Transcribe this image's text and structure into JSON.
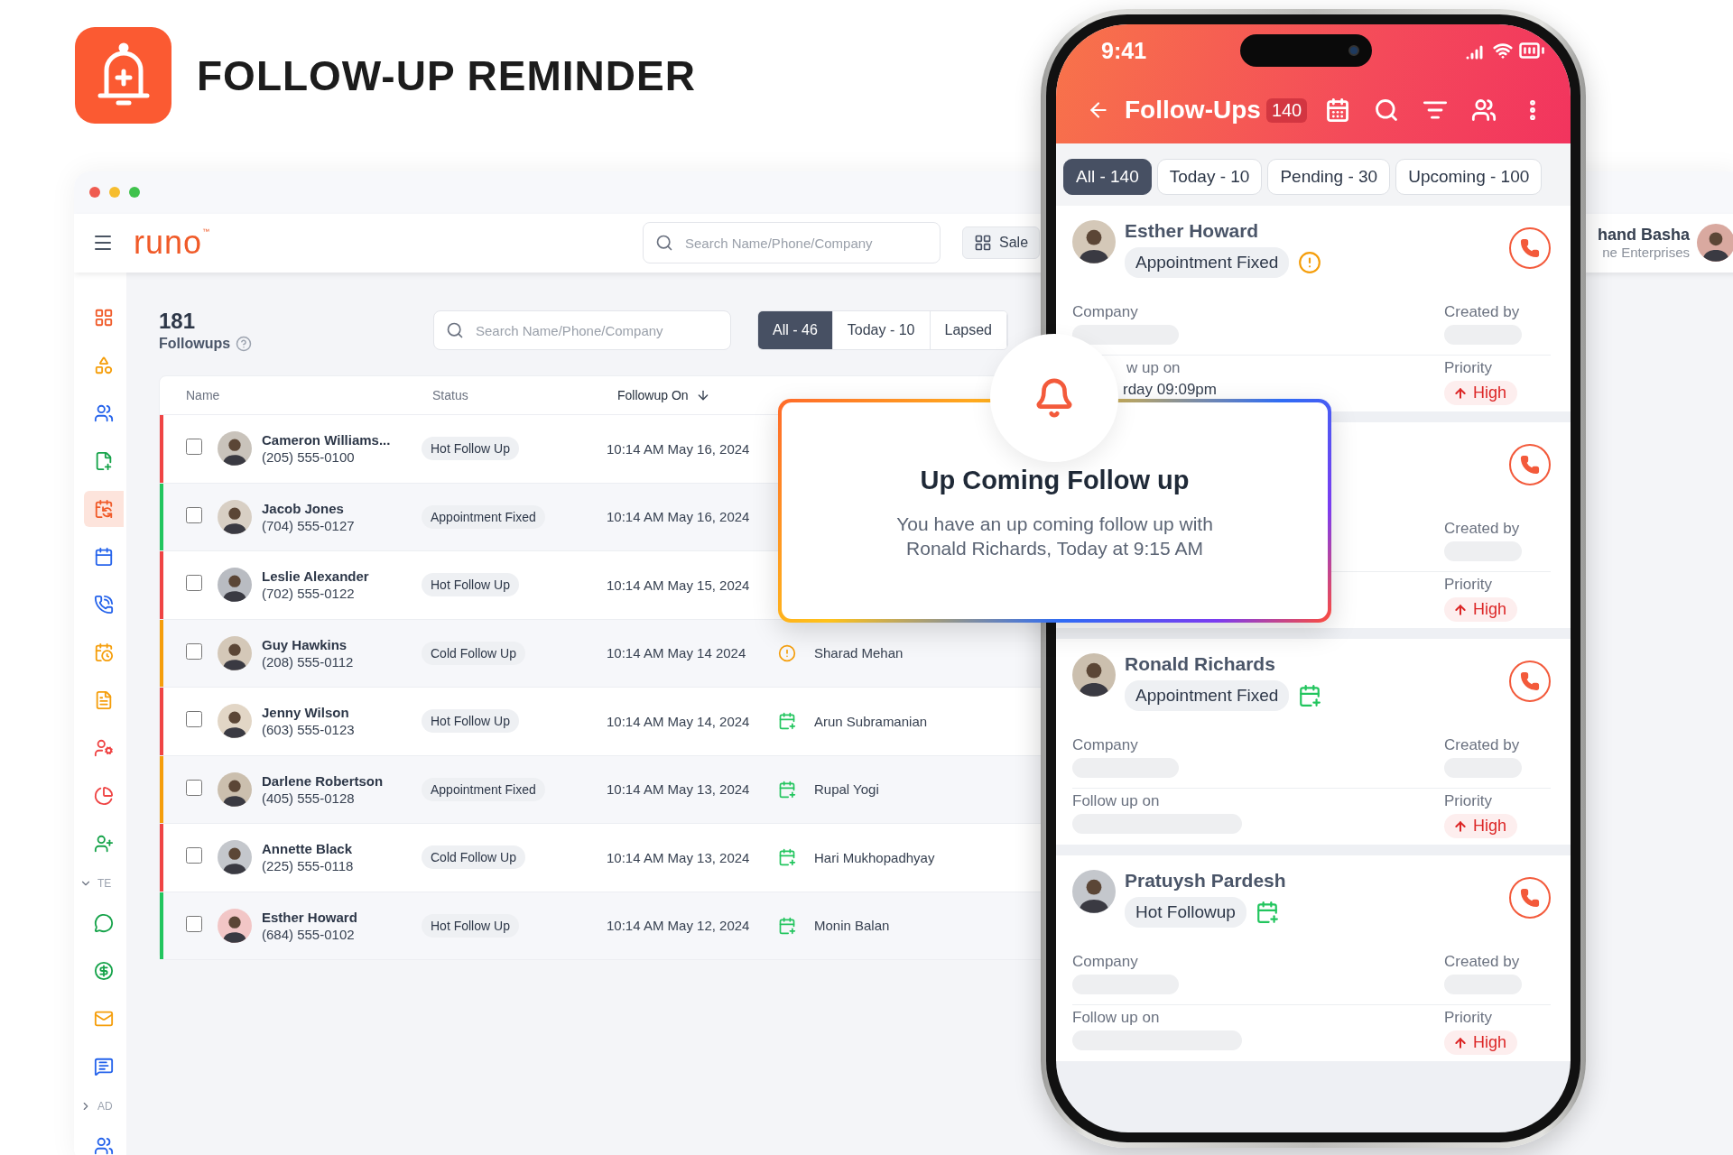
{
  "hero": {
    "title": "FOLLOW-UP REMINDER"
  },
  "desktop": {
    "brand": "runo",
    "brand_mark": "™",
    "search_placeholder": "Search Name/Phone/Company",
    "sales_button": "Sale",
    "user": {
      "name": "hand Basha",
      "company": "ne Enterprises"
    },
    "sidebar": [
      {
        "kind": "grid",
        "selected": false
      },
      {
        "kind": "shapes",
        "selected": false
      },
      {
        "kind": "team",
        "selected": false
      },
      {
        "kind": "list-add",
        "selected": false
      },
      {
        "kind": "calendar-sync",
        "selected": true
      },
      {
        "kind": "calendar",
        "selected": false
      },
      {
        "kind": "calls",
        "selected": false
      },
      {
        "kind": "calendar-clock",
        "selected": false
      },
      {
        "kind": "document",
        "selected": false
      },
      {
        "kind": "user-cog",
        "selected": false
      },
      {
        "kind": "pie",
        "selected": false
      },
      {
        "kind": "user-add",
        "selected": false
      },
      {
        "kind": "section",
        "label": "TE",
        "expanded": true
      },
      {
        "kind": "chat",
        "selected": false
      },
      {
        "kind": "coin",
        "selected": false
      },
      {
        "kind": "mail",
        "selected": false
      },
      {
        "kind": "message",
        "selected": false
      },
      {
        "kind": "section",
        "label": "AD",
        "expanded": false
      },
      {
        "kind": "team-user",
        "selected": false
      }
    ],
    "count": "181",
    "count_label": "Followups",
    "list_search_placeholder": "Search Name/Phone/Company",
    "tabs": [
      {
        "label": "All - 46",
        "selected": true
      },
      {
        "label": "Today - 10",
        "selected": false
      },
      {
        "label": "Lapsed",
        "selected": false
      }
    ],
    "columns": [
      {
        "label": "Name",
        "sorted": false
      },
      {
        "label": "Status",
        "sorted": false
      },
      {
        "label": "Followup On",
        "sorted": true
      }
    ],
    "rows": [
      {
        "checked": false,
        "name": "Cameron Williams...",
        "phone": "(205) 555-0100",
        "status": "Hot Follow Up",
        "followup_on": "10:14 AM May 16, 2024",
        "color": "#ef4444"
      },
      {
        "checked": false,
        "name": "Jacob Jones",
        "phone": "(704) 555-0127",
        "status": "Appointment Fixed",
        "followup_on": "10:14 AM May 16, 2024",
        "color": "#22c55e"
      },
      {
        "checked": false,
        "name": "Leslie Alexander",
        "phone": "(702) 555-0122",
        "status": "Hot Follow Up",
        "followup_on": "10:14 AM May 15, 2024",
        "color": "#ef4444"
      },
      {
        "checked": false,
        "name": "Guy Hawkins",
        "phone": "(208) 555-0112",
        "status": "Cold Follow Up",
        "followup_on": "10:14 AM May 14 2024",
        "flag": {
          "kind": "warning"
        },
        "owner": "Sharad Mehan",
        "color": "#f59e0b"
      },
      {
        "checked": false,
        "name": "Jenny Wilson",
        "phone": "(603) 555-0123",
        "status": "Hot Follow Up",
        "followup_on": "10:14 AM May 14, 2024",
        "flag": {
          "kind": "calendar"
        },
        "owner": "Arun Subramanian",
        "color": "#ef4444"
      },
      {
        "checked": false,
        "name": "Darlene Robertson",
        "phone": "(405) 555-0128",
        "status": "Appointment Fixed",
        "followup_on": "10:14 AM May 13, 2024",
        "flag": {
          "kind": "calendar"
        },
        "owner": "Rupal Yogi",
        "color": "#f59e0b"
      },
      {
        "checked": false,
        "name": "Annette Black",
        "phone": "(225) 555-0118",
        "status": "Cold Follow Up",
        "followup_on": "10:14 AM May 13, 2024",
        "flag": {
          "kind": "calendar"
        },
        "owner": "Hari Mukhopadhyay",
        "color": "#ef4444"
      },
      {
        "checked": false,
        "name": "Esther Howard",
        "phone": "(684) 555-0102",
        "status": "Hot Follow Up",
        "followup_on": "10:14 AM May 12, 2024",
        "flag": {
          "kind": "calendar"
        },
        "owner": "Monin Balan",
        "color": "#22c55e"
      }
    ]
  },
  "phone": {
    "time": "9:41",
    "title": "Follow-Ups",
    "count": "140",
    "tabs": [
      {
        "label": "All - 140",
        "selected": true
      },
      {
        "label": "Today - 10",
        "selected": false
      },
      {
        "label": "Pending - 30",
        "selected": false
      },
      {
        "label": "Upcoming - 100",
        "selected": false
      }
    ],
    "cards": [
      {
        "name": "Esther Howard",
        "status": "Appointment Fixed",
        "flag": {
          "kind": "warning"
        },
        "company_label": "Company",
        "created_by_label": "Created by",
        "follow_up_label": "w up on",
        "follow_up_value": "rday 09:09pm",
        "priority_label": "Priority",
        "priority": "High"
      },
      {
        "created_by_label": "Created by",
        "priority_label": "Priority",
        "priority": "High"
      },
      {
        "name": "Ronald Richards",
        "status": "Appointment Fixed",
        "flag": {
          "kind": "calendar"
        },
        "company_label": "Company",
        "created_by_label": "Created by",
        "follow_up_label": "Follow up on",
        "priority_label": "Priority",
        "priority": "High"
      },
      {
        "name": "Pratuysh Pardesh",
        "status": "Hot Followup",
        "flag": {
          "kind": "calendar"
        },
        "company_label": "Company",
        "created_by_label": "Created by",
        "follow_up_label": "Follow up on",
        "priority_label": "Priority",
        "priority": "High"
      }
    ]
  },
  "popup": {
    "title": "Up Coming Follow up",
    "message": "You have an up coming follow up with Ronald Richards, Today at 9:15 AM"
  }
}
